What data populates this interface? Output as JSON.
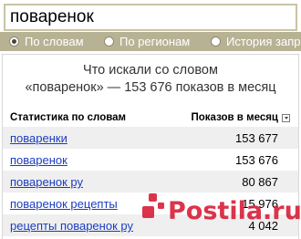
{
  "search": {
    "value": "поваренок"
  },
  "modes": [
    {
      "label": "По словам",
      "checked": true
    },
    {
      "label": "По регионам",
      "checked": false
    },
    {
      "label": "История запросов",
      "checked": false
    }
  ],
  "summary": {
    "line1": "Что искали со словом",
    "line2": "«поваренок» — 153 676 показов в месяц"
  },
  "table": {
    "col_words": "Статистика по словам",
    "col_impressions": "Показов в месяц",
    "rows": [
      {
        "phrase": "поваренки",
        "count": "153 677"
      },
      {
        "phrase": "поваренок",
        "count": "153 676"
      },
      {
        "phrase": "поваренок ру",
        "count": "80 867"
      },
      {
        "phrase": "поваренок рецепты",
        "count": "15 976"
      },
      {
        "phrase": "рецепты поваренок ру",
        "count": "4 042"
      }
    ]
  },
  "watermark": {
    "text": "Postila.ru",
    "color": "#d8233c"
  },
  "colors": {
    "mode_bar": "#b8b295",
    "link": "#1a3dc1",
    "row_shade": "#efefef"
  }
}
